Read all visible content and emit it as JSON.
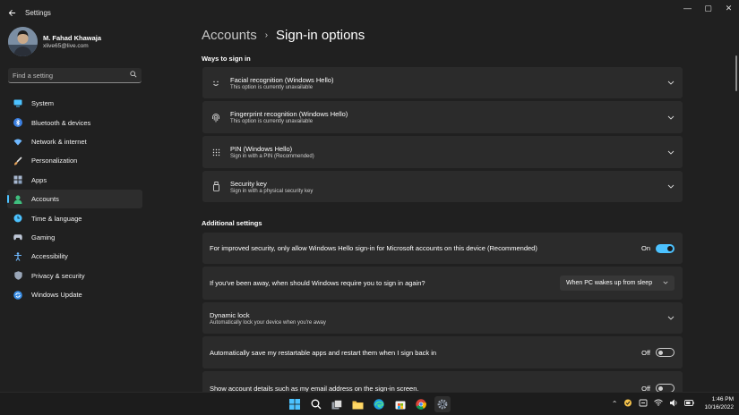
{
  "window": {
    "title": "Settings",
    "back_icon": "arrow-left-icon",
    "controls": {
      "minimize": "—",
      "maximize": "▢",
      "close": "✕"
    }
  },
  "profile": {
    "name": "M. Fahad Khawaja",
    "email": "xlive65@live.com"
  },
  "search": {
    "placeholder": "Find a setting"
  },
  "sidebar": {
    "items": [
      {
        "label": "System",
        "icon": "monitor-icon",
        "color": "#4cc2ff",
        "active": false
      },
      {
        "label": "Bluetooth & devices",
        "icon": "bluetooth-icon",
        "color": "#4c9bff",
        "active": false
      },
      {
        "label": "Network & internet",
        "icon": "wifi-icon",
        "color": "#6fb8ff",
        "active": false
      },
      {
        "label": "Personalization",
        "icon": "brush-icon",
        "color": "#e8a35a",
        "active": false
      },
      {
        "label": "Apps",
        "icon": "apps-icon",
        "color": "#a8b8d0",
        "active": false
      },
      {
        "label": "Accounts",
        "icon": "person-icon",
        "color": "#3fbf7f",
        "active": true
      },
      {
        "label": "Time & language",
        "icon": "globe-clock-icon",
        "color": "#4cc2ff",
        "active": false
      },
      {
        "label": "Gaming",
        "icon": "gamepad-icon",
        "color": "#c0c8d8",
        "active": false
      },
      {
        "label": "Accessibility",
        "icon": "accessibility-icon",
        "color": "#6fb8ff",
        "active": false
      },
      {
        "label": "Privacy & security",
        "icon": "shield-icon",
        "color": "#9aa6b8",
        "active": false
      },
      {
        "label": "Windows Update",
        "icon": "update-icon",
        "color": "#4c9bff",
        "active": false
      }
    ]
  },
  "breadcrumb": {
    "parent": "Accounts",
    "separator": "›",
    "current": "Sign-in options"
  },
  "ways_to_sign_in": {
    "heading": "Ways to sign in",
    "items": [
      {
        "title": "Facial recognition (Windows Hello)",
        "subtitle": "This option is currently unavailable",
        "icon": "face-icon"
      },
      {
        "title": "Fingerprint recognition (Windows Hello)",
        "subtitle": "This option is currently unavailable",
        "icon": "fingerprint-icon"
      },
      {
        "title": "PIN (Windows Hello)",
        "subtitle": "Sign in with a PIN (Recommended)",
        "icon": "pin-keypad-icon"
      },
      {
        "title": "Security key",
        "subtitle": "Sign in with a physical security key",
        "icon": "usb-key-icon"
      }
    ]
  },
  "additional_settings": {
    "heading": "Additional settings",
    "hello_only": {
      "text": "For improved security, only allow Windows Hello sign-in for Microsoft accounts on this device (Recommended)",
      "state": "On"
    },
    "require_signin": {
      "text": "If you've been away, when should Windows require you to sign in again?",
      "value": "When PC wakes up from sleep"
    },
    "dynamic_lock": {
      "title": "Dynamic lock",
      "subtitle": "Automatically lock your device when you're away"
    },
    "restart_apps": {
      "text": "Automatically save my restartable apps and restart them when I sign back in",
      "state": "Off"
    },
    "account_details": {
      "text": "Show account details such as my email address on the sign-in screen.",
      "state": "Off"
    }
  },
  "taskbar": {
    "apps": [
      "windows-start-icon",
      "search-icon",
      "task-view-icon",
      "file-explorer-icon",
      "edge-icon",
      "store-icon",
      "chrome-icon",
      "settings-gear-icon"
    ],
    "tray": [
      "chevron-up-icon",
      "onedrive-icon",
      "bluetooth-tray-icon",
      "wifi-icon",
      "volume-icon",
      "battery-icon"
    ],
    "time": "1:46 PM",
    "date": "10/16/2022"
  },
  "colors": {
    "accent": "#4cc2ff",
    "background": "#202020",
    "card": "#2b2b2b"
  }
}
